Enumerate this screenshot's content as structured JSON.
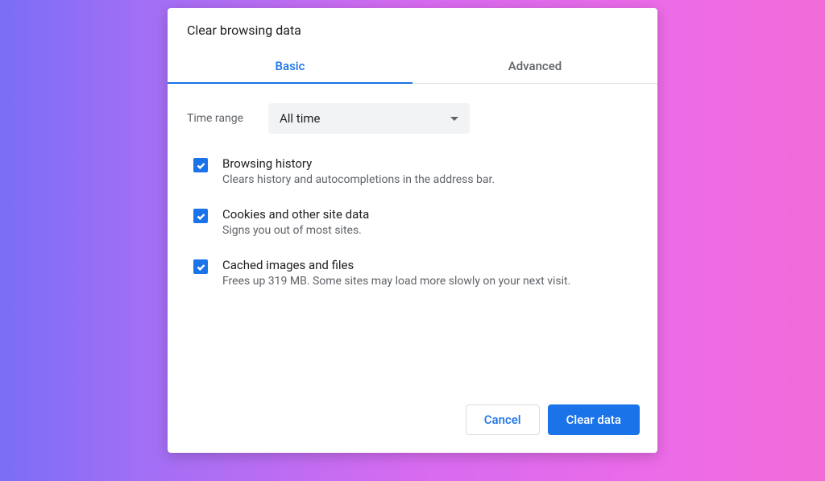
{
  "dialog": {
    "title": "Clear browsing data",
    "tabs": {
      "basic": "Basic",
      "advanced": "Advanced"
    },
    "time_range": {
      "label": "Time range",
      "value": "All time"
    },
    "items": [
      {
        "title": "Browsing history",
        "desc": "Clears history and autocompletions in the address bar."
      },
      {
        "title": "Cookies and other site data",
        "desc": "Signs you out of most sites."
      },
      {
        "title": "Cached images and files",
        "desc": "Frees up 319 MB. Some sites may load more slowly on your next visit."
      }
    ],
    "footer": {
      "cancel": "Cancel",
      "clear": "Clear data"
    }
  }
}
